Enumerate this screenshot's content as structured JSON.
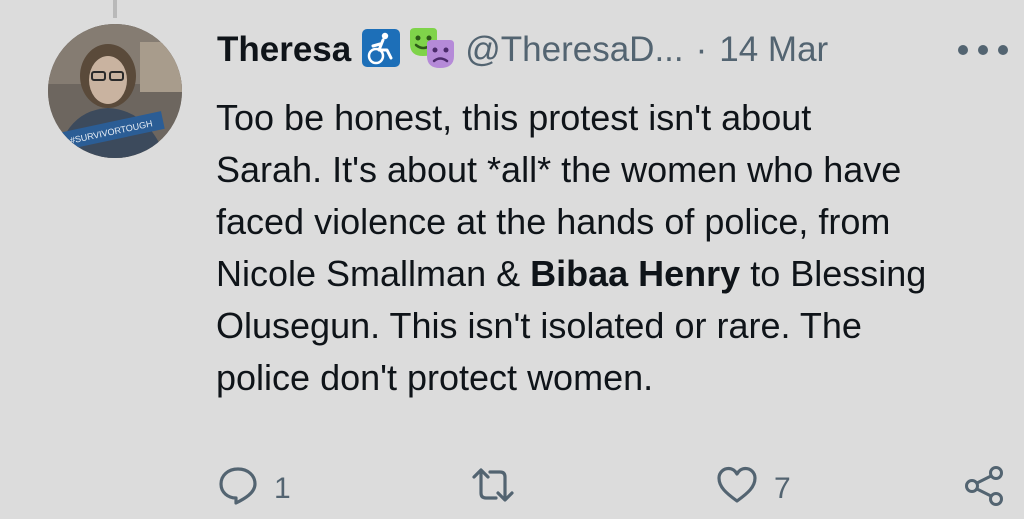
{
  "tweet": {
    "author_name": "Theresa",
    "author_handle": "@TheresaD...",
    "separator": "·",
    "date": "14 Mar",
    "avatar_text": "#SURVIVORTOUGH",
    "badges": [
      "wheelchair-icon",
      "theatre-masks-icon"
    ],
    "body": {
      "line1": "Too be honest, this protest isn't about",
      "line2": "Sarah. It's about *all* the women who have",
      "line3": "faced violence at the hands of police, from",
      "line4_pre": "Nicole Smallman & ",
      "line4_bold": "Bibaa Henry",
      "line4_post": " to Blessing",
      "line5": "Olusegun. This isn't isolated or rare. The",
      "line6": "police don't protect women."
    },
    "actions": {
      "reply_count": "1",
      "retweet_count": "",
      "like_count": "7"
    }
  },
  "colors": {
    "background": "#dcdcdc",
    "text_primary": "#0f1419",
    "text_secondary": "#536471",
    "badge_blue": "#1d6fb8"
  }
}
